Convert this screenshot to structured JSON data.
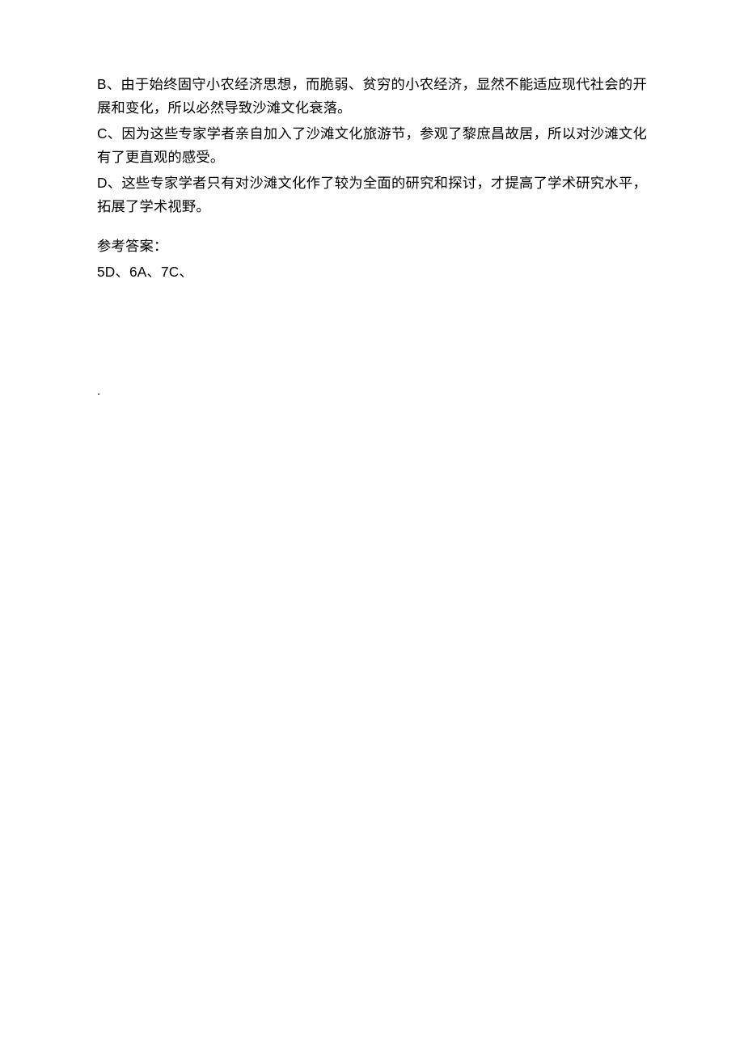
{
  "options": {
    "B": "B、由于始终固守小农经济思想，而脆弱、贫穷的小农经济，显然不能适应现代社会的开展和变化，所以必然导致沙滩文化衰落。",
    "C": "C、因为这些专家学者亲自加入了沙滩文化旅游节，参观了黎庶昌故居，所以对沙滩文化有了更直观的感受。",
    "D": "D、这些专家学者只有对沙滩文化作了较为全面的研究和探讨，才提高了学术研究水平，拓展了学术视野。"
  },
  "answer": {
    "title": "参考答案：",
    "list": "5D、6A、7C、"
  },
  "dot": "."
}
